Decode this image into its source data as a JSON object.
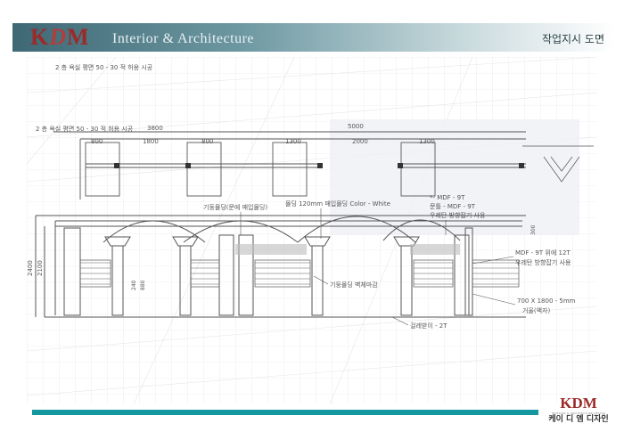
{
  "header": {
    "logo": {
      "k": "K",
      "d": "D",
      "m": "M"
    },
    "subtitle": "Interior & Architecture",
    "document_title": "작업지시 도면"
  },
  "drawing": {
    "faint_note_1": "2 층 욕실 평면 50 - 30 적 허용 시공",
    "faint_note_2": "2 층 욕실 평면 50 - 30 적 허용 시공",
    "plan_dims_top": [
      "3800",
      "5000"
    ],
    "plan_dims_row": [
      "800",
      "1800",
      "800",
      "1300",
      "2000",
      "1300"
    ],
    "height_dims": [
      "2400",
      "2100"
    ],
    "inner_dims": [
      "240",
      "880"
    ],
    "right_dim": "300",
    "note_column": "기둥몰딩(문에 매입몰딩)",
    "note_cornice": "몰딩 120mm 매입몰딩 Color - White",
    "note_mdf_1": "*- MDF - 9T",
    "note_mdf_2": "문틀 - MDF - 9T",
    "note_mdf_3": "우레탄 방향잡기 사용",
    "note_wall_1": "MDF - 9T 위에 12T",
    "note_wall_2": "우레탄 방향잡기 사용",
    "note_pillar": "기둥몰딩 벽체마감",
    "note_size_1": "700 X 1800 - 5mm",
    "note_size_2": "거울(액자)",
    "note_base": "걸레받이 - 2T"
  },
  "footer": {
    "logo": "KDM",
    "tagline": "INTERIOR & ARCHITECTURE DESIGN",
    "company": "케이 디 엠 디자인"
  },
  "colors": {
    "logo_red": "#9b2a2a",
    "header_teal": "#3e6874",
    "footer_bar": "#14979e",
    "pencil": "#555555"
  }
}
